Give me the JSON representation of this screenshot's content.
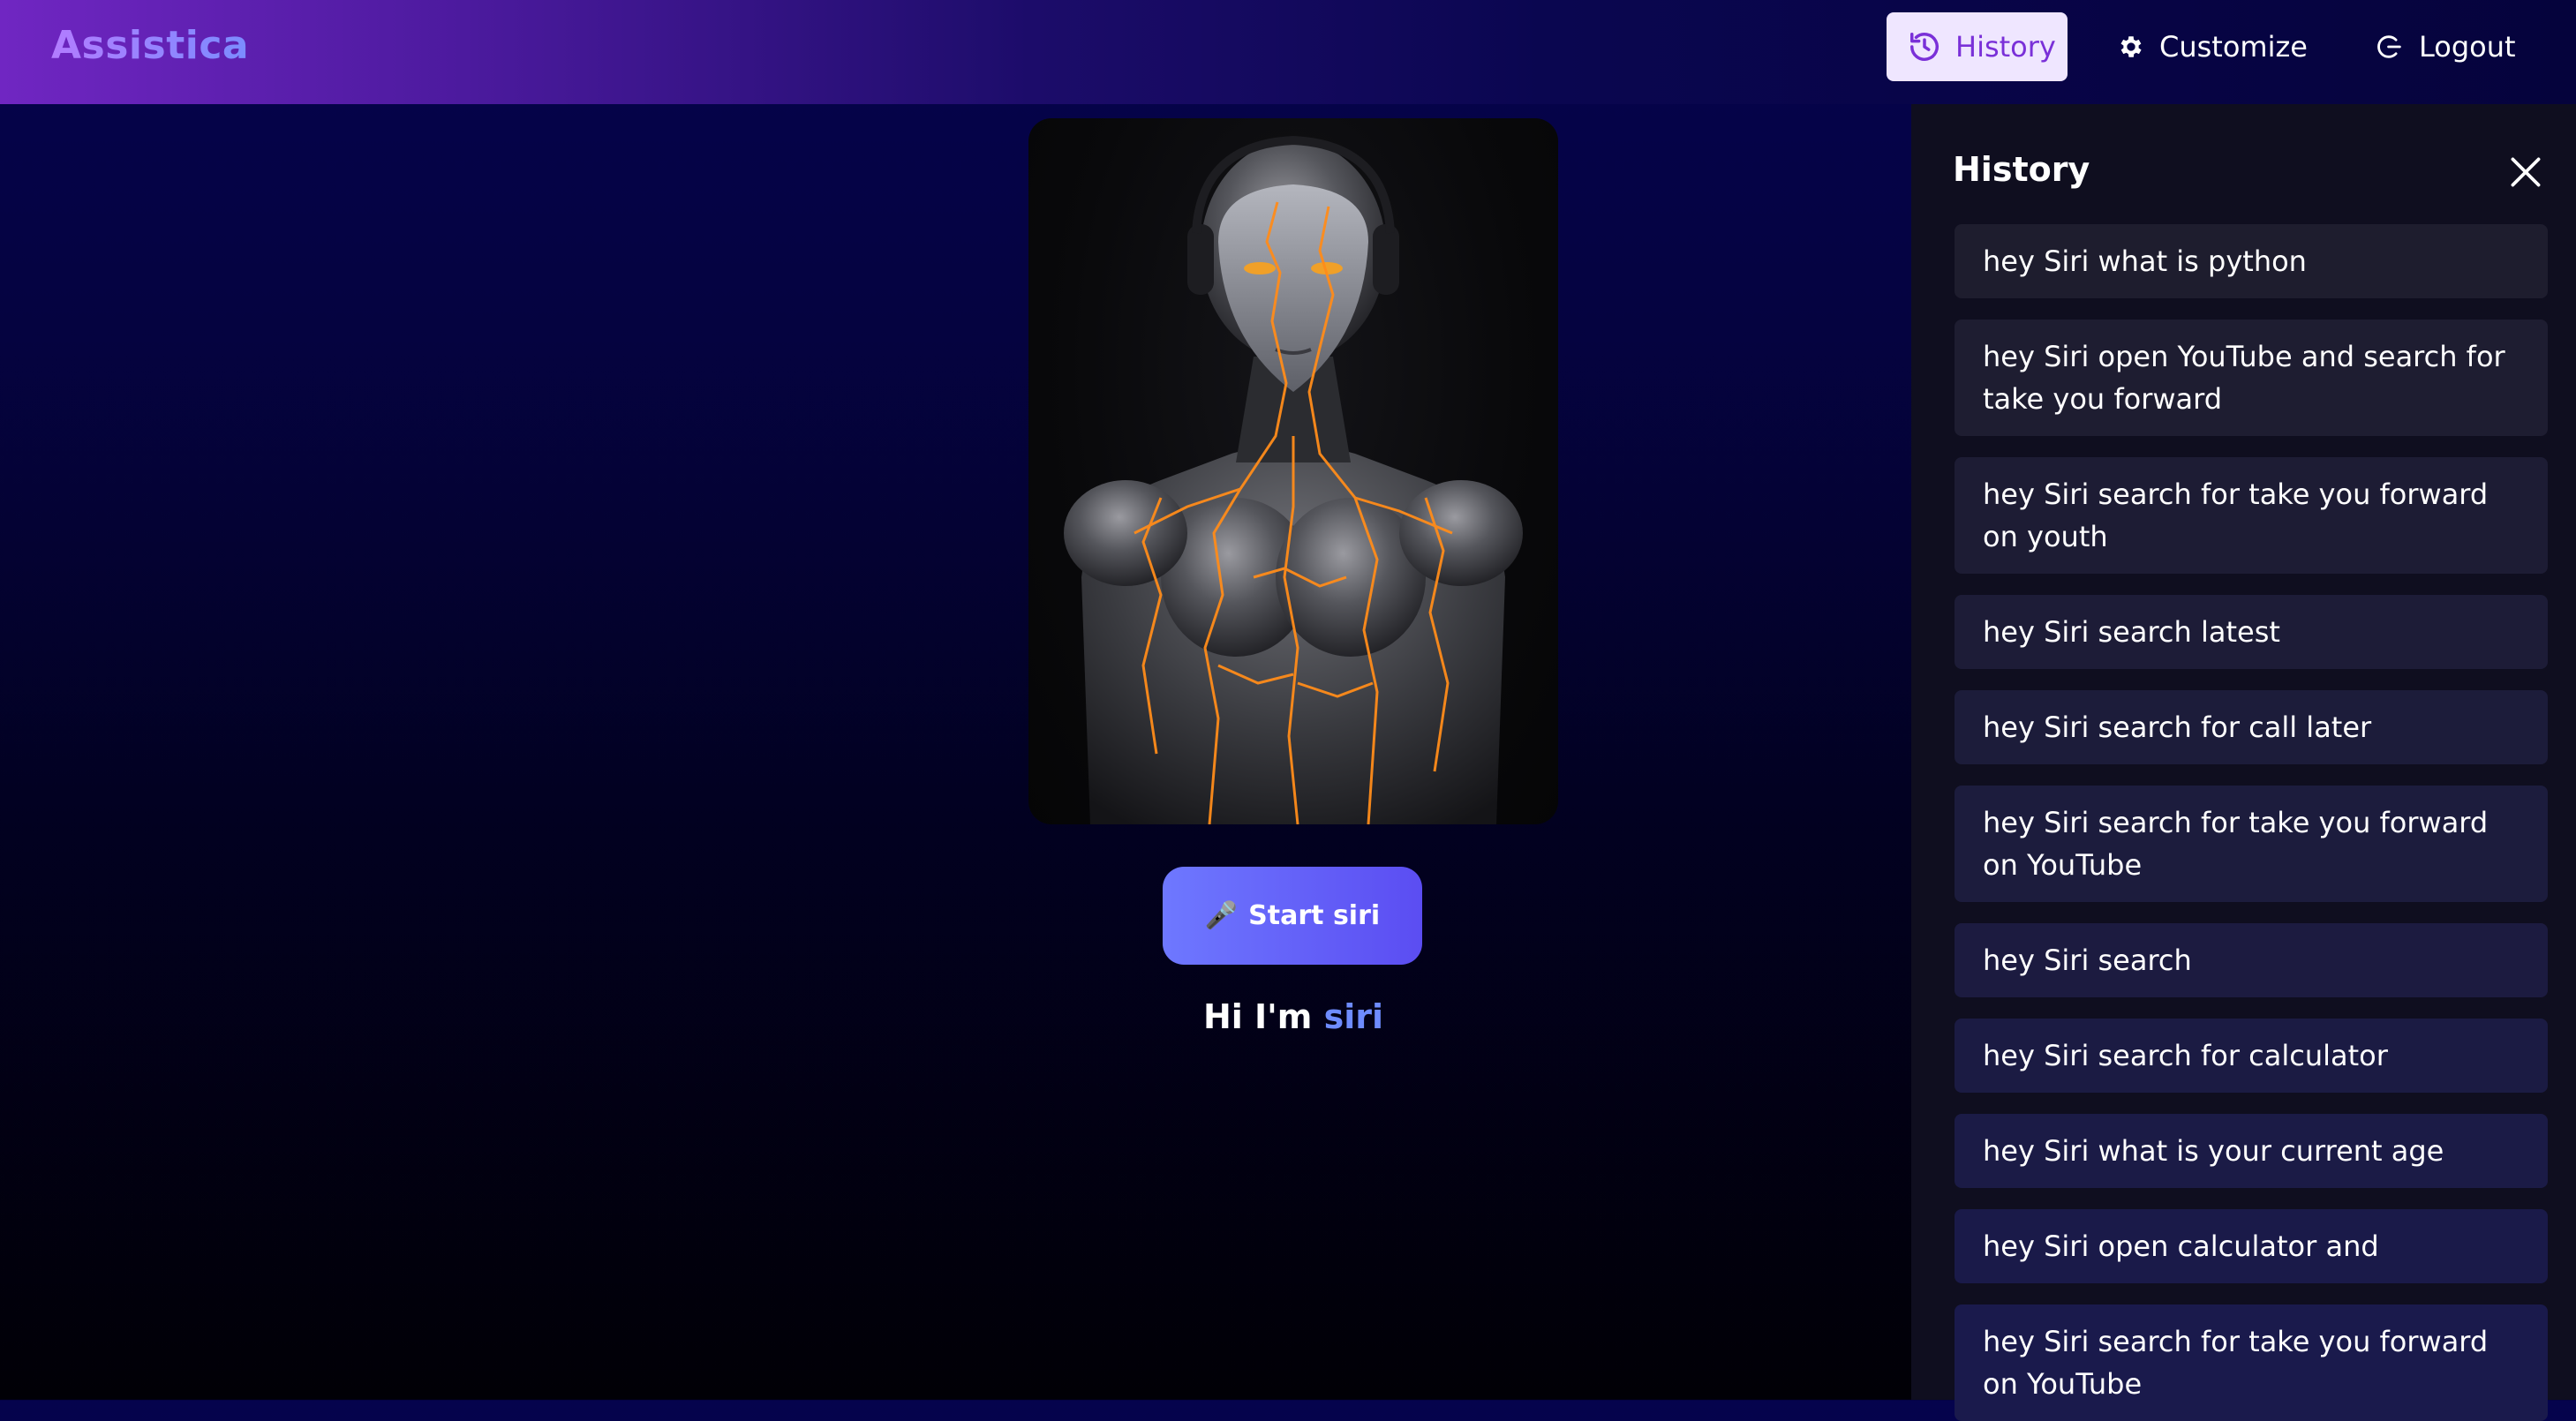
{
  "brand": {
    "name": "Assistica"
  },
  "nav": {
    "history": {
      "label": "History",
      "icon": "history-icon",
      "active": true
    },
    "customize": {
      "label": "Customize",
      "icon": "gear-icon"
    },
    "logout": {
      "label": "Logout",
      "icon": "logout-icon"
    }
  },
  "main": {
    "portrait": {
      "subject": "android woman portrait"
    },
    "start_button": {
      "icon": "🎤",
      "label": "Start siri"
    },
    "greeting": {
      "prefix": "Hi I'm",
      "name": "siri"
    }
  },
  "history": {
    "title": "History",
    "close_icon": "close-icon",
    "items": [
      {
        "text": "hey Siri what is python"
      },
      {
        "text": "hey Siri open YouTube and search for take you forward"
      },
      {
        "text": "hey Siri search for take you forward on youth"
      },
      {
        "text": "hey Siri search latest"
      },
      {
        "text": "hey Siri search for call later"
      },
      {
        "text": "hey Siri search for take you forward on YouTube"
      },
      {
        "text": "hey Siri search"
      },
      {
        "text": "hey Siri search for calculator"
      },
      {
        "text": "hey Siri what is your current age"
      },
      {
        "text": "hey Siri open calculator and"
      },
      {
        "text": "hey Siri search for take you forward on YouTube"
      }
    ]
  },
  "colors": {
    "accent": "#7a30d8",
    "button_gradient_start": "#6e78ff",
    "button_gradient_end": "#5b4df2",
    "highlight": "#6e8cff",
    "panel_bg": "#0f0e1f",
    "item_bg": "#1e1d2e"
  }
}
